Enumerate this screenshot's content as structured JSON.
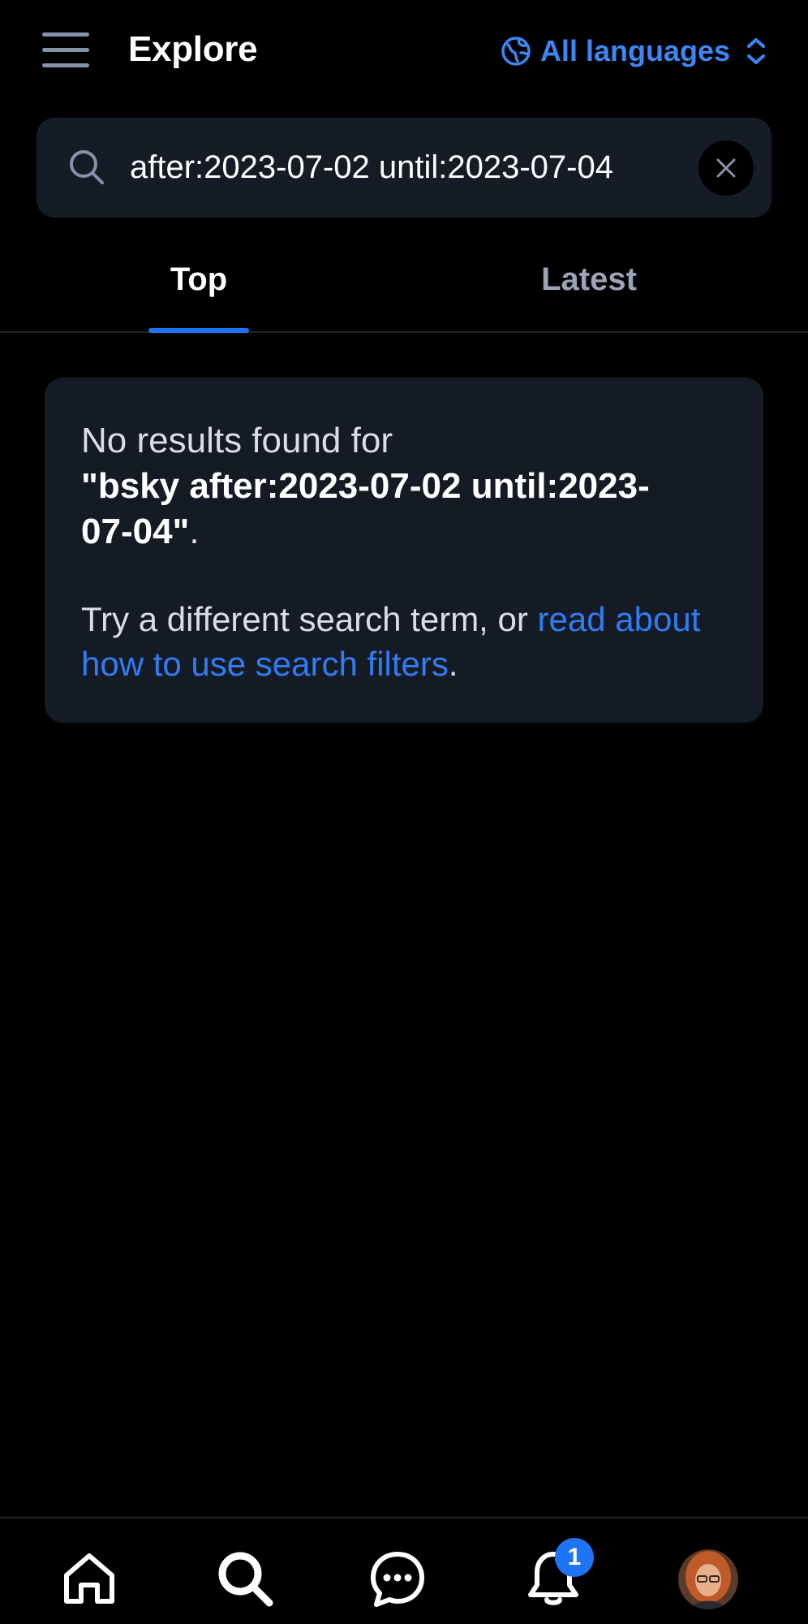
{
  "header": {
    "title": "Explore",
    "language_label": "All languages"
  },
  "search": {
    "value": "after:2023-07-02 until:2023-07-04",
    "placeholder": ""
  },
  "tabs": [
    {
      "label": "Top",
      "active": true
    },
    {
      "label": "Latest",
      "active": false
    }
  ],
  "results": {
    "no_results_prefix": "No results found for",
    "query": "\"bsky after:2023-07-02 until:2023-07-04\"",
    "query_suffix": ".",
    "hint_prefix": "Try a different search term, or ",
    "hint_link": "read about how to use search filters",
    "hint_suffix": "."
  },
  "bottom_nav": {
    "notification_count": "1"
  },
  "colors": {
    "accent": "#1d74f5",
    "link": "#2f7df5",
    "card_bg": "#151b25",
    "background": "#000000"
  }
}
